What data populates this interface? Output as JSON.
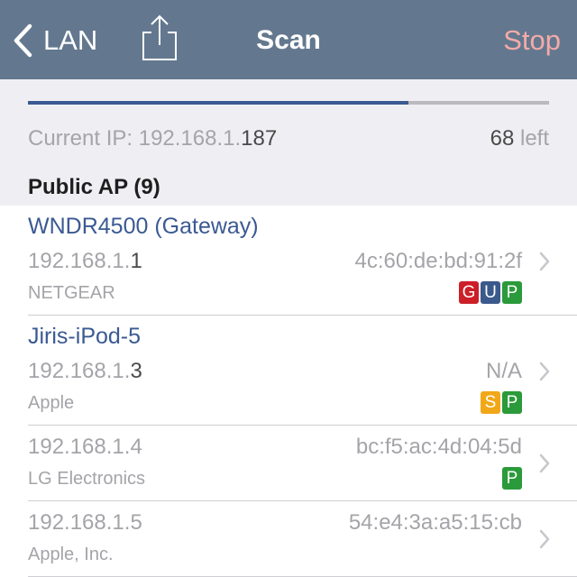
{
  "nav": {
    "back_label": "LAN",
    "title": "Scan",
    "stop_label": "Stop"
  },
  "scan": {
    "progress": 0.73,
    "current_ip_label": "Current IP:",
    "current_ip_prefix": "192.168.1.",
    "current_ip_suffix": "187",
    "left_count": "68",
    "left_label": "left"
  },
  "section": {
    "title": "Public AP (9)"
  },
  "devices": [
    {
      "name": "WNDR4500 (Gateway)",
      "ip_prefix": "192.168.1.",
      "ip_suffix": "1",
      "mac": "4c:60:de:bd:91:2f",
      "vendor": "NETGEAR",
      "badges": [
        {
          "letter": "G",
          "color": "#cc1f27"
        },
        {
          "letter": "U",
          "color": "#3a5a8c"
        },
        {
          "letter": "P",
          "color": "#2b9a3a"
        }
      ]
    },
    {
      "name": "Jiris-iPod-5",
      "ip_prefix": "192.168.1.",
      "ip_suffix": "3",
      "mac": "N/A",
      "vendor": "Apple",
      "badges": [
        {
          "letter": "S",
          "color": "#f0a818"
        },
        {
          "letter": "P",
          "color": "#2b9a3a"
        }
      ]
    },
    {
      "name": "",
      "ip_prefix": "192.168.1.",
      "ip_suffix": "4",
      "mac": "bc:f5:ac:4d:04:5d",
      "vendor": "LG Electronics",
      "badges": [
        {
          "letter": "P",
          "color": "#2b9a3a"
        }
      ]
    },
    {
      "name": "",
      "ip_prefix": "192.168.1.",
      "ip_suffix": "5",
      "mac": "54:e4:3a:a5:15:cb",
      "vendor": "Apple, Inc.",
      "badges": []
    }
  ],
  "colors": {
    "navbar": "#63788f",
    "accent_blue": "#3b5a92",
    "stop": "#f4aaa8",
    "status_bg": "#efeff3"
  },
  "icons": {
    "back": "chevron-left-icon",
    "share": "share-icon",
    "disclosure": "chevron-right-icon"
  }
}
